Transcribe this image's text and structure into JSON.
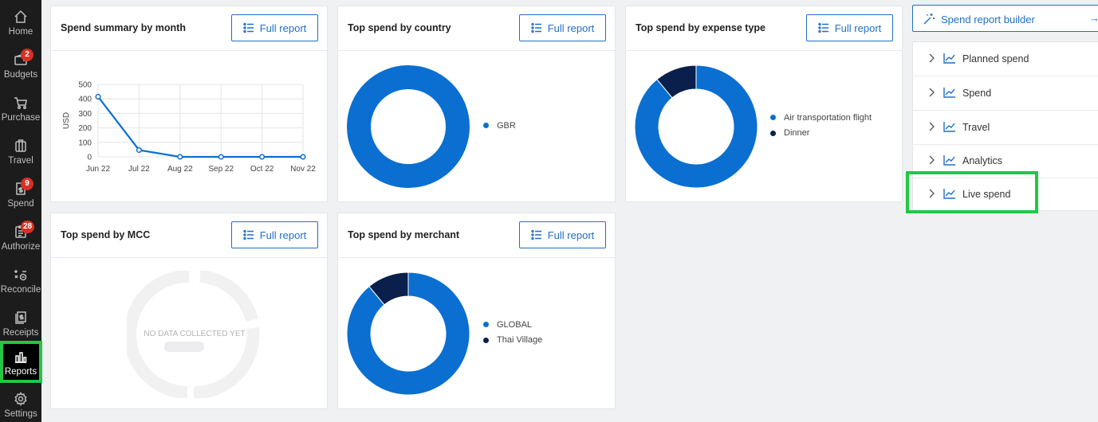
{
  "sidebar": {
    "items": [
      {
        "label": "Home",
        "icon": "home-icon",
        "badge": ""
      },
      {
        "label": "Budgets",
        "icon": "wallet-icon",
        "badge": "2"
      },
      {
        "label": "Purchase",
        "icon": "cart-icon",
        "badge": ""
      },
      {
        "label": "Travel",
        "icon": "luggage-icon",
        "badge": ""
      },
      {
        "label": "Spend",
        "icon": "receipt-dollar-icon",
        "badge": "9"
      },
      {
        "label": "Authorize",
        "icon": "clipboard-check-icon",
        "badge": "28"
      },
      {
        "label": "Reconcile",
        "icon": "reconcile-icon",
        "badge": ""
      },
      {
        "label": "Receipts",
        "icon": "receipts-icon",
        "badge": ""
      },
      {
        "label": "Reports",
        "icon": "bar-chart-icon",
        "badge": "",
        "active": true
      },
      {
        "label": "Settings",
        "icon": "gear-icon",
        "badge": ""
      }
    ]
  },
  "cards": {
    "month": {
      "title": "Spend summary by month",
      "button": "Full report"
    },
    "country": {
      "title": "Top spend by country",
      "button": "Full report"
    },
    "expense": {
      "title": "Top spend by expense type",
      "button": "Full report"
    },
    "mcc": {
      "title": "Top spend by MCC",
      "button": "Full report",
      "empty_text": "NO DATA COLLECTED YET"
    },
    "merchant": {
      "title": "Top spend by merchant",
      "button": "Full report"
    }
  },
  "right_panel": {
    "builder_label": "Spend report builder",
    "builder_arrow": "→",
    "items": [
      "Planned spend",
      "Spend",
      "Travel",
      "Analytics",
      "Live spend"
    ]
  },
  "colors": {
    "primary": "#0a6fd1",
    "dark_navy": "#0b1f4d",
    "accent": "#1f6fc8",
    "highlight": "#22c744",
    "badge": "#d93025"
  },
  "chart_data": [
    {
      "type": "line",
      "ylabel": "USD",
      "categories": [
        "Jun 22",
        "Jul 22",
        "Aug 22",
        "Sep 22",
        "Oct 22",
        "Nov 22"
      ],
      "values": [
        415,
        47,
        0,
        0,
        0,
        0
      ],
      "ylim": [
        0,
        500
      ],
      "yticks": [
        0,
        100,
        200,
        300,
        400,
        500
      ],
      "grid": true
    },
    {
      "type": "pie",
      "variant": "donut",
      "slices": [
        {
          "label": "GBR",
          "value": 100,
          "color": "#0a6fd1"
        }
      ]
    },
    {
      "type": "pie",
      "variant": "donut",
      "slices": [
        {
          "label": "Air transportation flight",
          "value": 89,
          "color": "#0a6fd1"
        },
        {
          "label": "Dinner",
          "value": 11,
          "color": "#0b1f4d"
        }
      ]
    },
    {
      "type": "pie",
      "variant": "donut",
      "slices": [
        {
          "label": "GLOBAL",
          "value": 89,
          "color": "#0a6fd1"
        },
        {
          "label": "Thai Village",
          "value": 11,
          "color": "#0b1f4d"
        }
      ]
    }
  ]
}
